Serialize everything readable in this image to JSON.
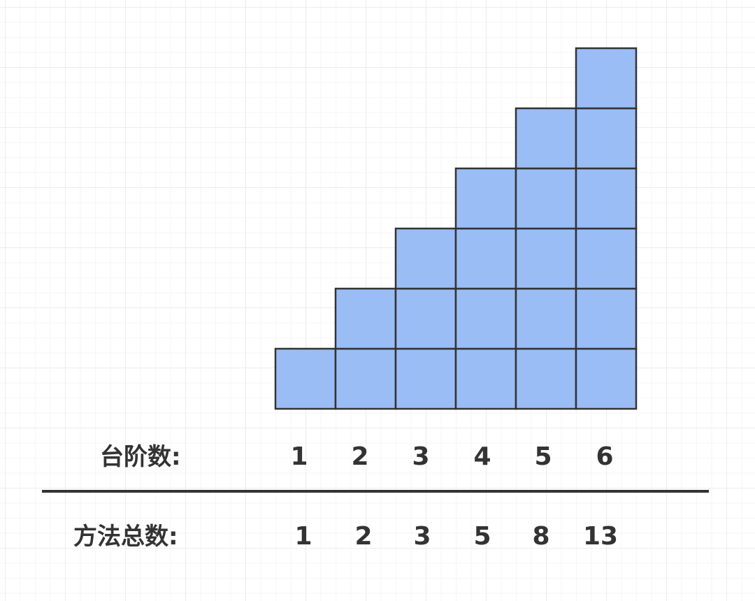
{
  "labels": {
    "steps": "台阶数:",
    "ways": "方法总数:"
  },
  "steps": [
    "1",
    "2",
    "3",
    "4",
    "5",
    "6"
  ],
  "ways": [
    "1",
    "2",
    "3",
    "5",
    "8",
    "13"
  ],
  "column_heights": [
    1,
    2,
    3,
    4,
    5,
    6
  ],
  "colors": {
    "block_fill": "#9ABDF5",
    "block_stroke": "#333333",
    "text": "#333333"
  }
}
